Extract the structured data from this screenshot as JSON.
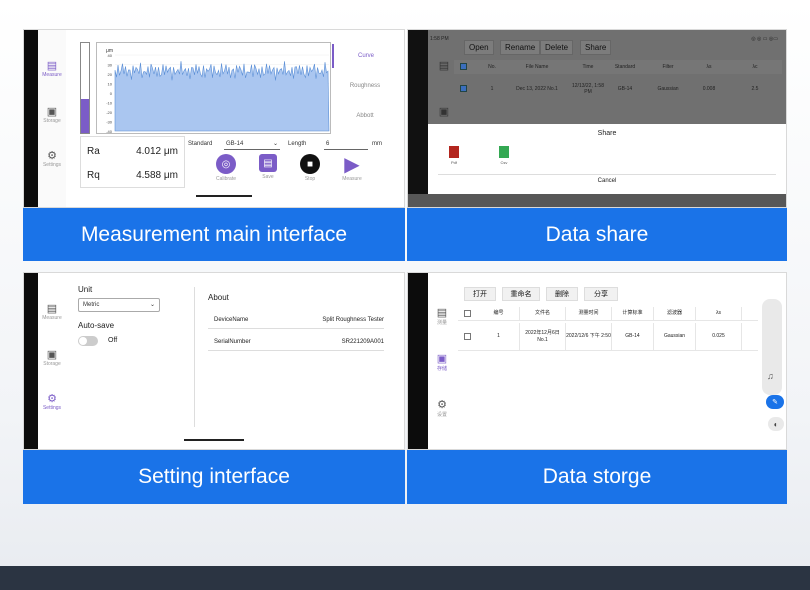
{
  "captions": {
    "measurement": "Measurement main interface",
    "share": "Data share",
    "setting": "Setting interface",
    "storage": "Data storge"
  },
  "measurement": {
    "sidebar": {
      "measure": "Measure",
      "storage": "Storage",
      "settings": "Settings"
    },
    "chart_unit": "μm",
    "y_ticks": [
      "40",
      "30",
      "20",
      "10",
      "0",
      "-10",
      "-20",
      "-30",
      "-40"
    ],
    "gauge_level": 0.38,
    "tabs": {
      "curve": "Curve",
      "roughness": "Roughness",
      "abbott": "Abbott"
    },
    "ra_name": "Ra",
    "ra_value": "4.012 μm",
    "rq_name": "Rq",
    "rq_value": "4.588 μm",
    "standard_label": "Standard",
    "standard_value": "GB-14",
    "length_label": "Length",
    "length_value": "6",
    "length_unit": "mm",
    "actions": {
      "calibrate": "Calibrate",
      "save": "Save",
      "stop": "Stop",
      "measure": "Measure"
    },
    "colors": {
      "accent": "#7b5cc7",
      "wave": "#5b8fd6"
    }
  },
  "share": {
    "status_time": "1:58 PM",
    "status_right": "◎ ◎ ▭ ◎▭",
    "toolbar": {
      "open": "Open",
      "rename": "Rename",
      "delete": "Delete",
      "share": "Share"
    },
    "headers": {
      "no": "No.",
      "file_name": "File Name",
      "time": "Time",
      "standard": "Standard",
      "filter": "Filter",
      "xs": "λs",
      "xc": "λc"
    },
    "row": {
      "no": "1",
      "file_name": "Dec 13, 2022 No.1",
      "time": "12/13/22, 1:58 PM",
      "standard": "GB-14",
      "filter": "Gaussian",
      "xs": "0.008",
      "xc": "2.5"
    },
    "sheet_title": "Share",
    "options": {
      "pdf": "Pdf",
      "csv": "Csv"
    },
    "cancel": "Cancel"
  },
  "setting": {
    "sidebar": {
      "measure": "Measure",
      "storage": "Storage",
      "settings": "Settings"
    },
    "unit_label": "Unit",
    "unit_value": "Metric",
    "autosave_label": "Auto-save",
    "autosave_value": "Off",
    "about_label": "About",
    "device_name_key": "DeviceName",
    "device_name_value": "Split Roughness Tester",
    "serial_key": "SerialNumber",
    "serial_value": "SR221209A001"
  },
  "storage": {
    "sidebar": {
      "measure": "测量",
      "storage": "存储",
      "settings": "设置"
    },
    "toolbar": {
      "open": "打开",
      "rename": "重命名",
      "delete": "删除",
      "share": "分享"
    },
    "headers": {
      "no": "编号",
      "file_name": "文件名",
      "time": "测量时间",
      "standard": "计算标准",
      "filter": "滤波器",
      "xs": "λs"
    },
    "row": {
      "no": "1",
      "file_name": "2022年12月6日 No.1",
      "time": "2022/12/6 下午 2:50",
      "standard": "GB-14",
      "filter": "Gaussian",
      "xs": "0.025"
    }
  }
}
